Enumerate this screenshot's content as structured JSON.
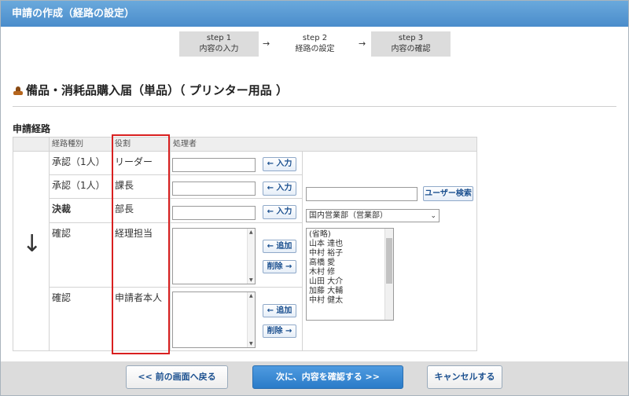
{
  "window": {
    "title": "申請の作成（経路の設定）"
  },
  "steps": [
    {
      "num": "step 1",
      "label": "内容の入力"
    },
    {
      "num": "step 2",
      "label": "経路の設定"
    },
    {
      "num": "step 3",
      "label": "内容の確認"
    }
  ],
  "step_arrow": "→",
  "form": {
    "heading": "備品・消耗品購入届（単品）（ プリンター用品 ）"
  },
  "route": {
    "section_label": "申請経路",
    "headers": {
      "kind": "経路種別",
      "role": "役割",
      "processor": "処理者"
    },
    "rows": [
      {
        "kind": "承認（1人）",
        "role": "リーダー"
      },
      {
        "kind": "承認（1人）",
        "role": "課長"
      },
      {
        "kind": "決裁",
        "role": "部長"
      },
      {
        "kind": "確認",
        "role": "経理担当"
      },
      {
        "kind": "確認",
        "role": "申請者本人"
      }
    ],
    "down_arrow": "↓",
    "input_button": "← 入力",
    "add_button": "← 追加",
    "delete_button": "削除 →"
  },
  "user_search": {
    "button": "ユーザー検索",
    "department": "国内営業部（営業部）",
    "users": [
      "(省略)",
      "山本 達也",
      "中村 裕子",
      "高橋 愛",
      "木村 修",
      "山田 大介",
      "加藤 大輔",
      "中村 健太"
    ]
  },
  "footer": {
    "back": "<< 前の画面へ戻る",
    "next": "次に、内容を確認する >>",
    "cancel": "キャンセルする"
  },
  "colors": {
    "titlebar": "#4a8ccb",
    "highlight": "#d92020",
    "kessai": "#cc1111",
    "primary_button": "#2a7bc8"
  }
}
